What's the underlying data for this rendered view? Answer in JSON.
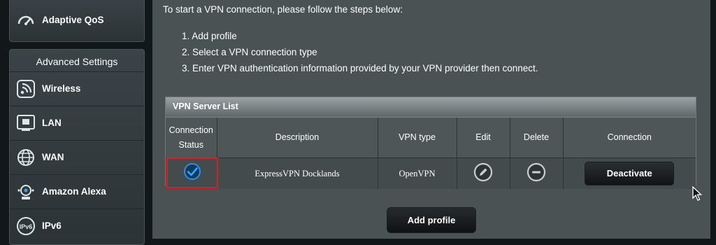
{
  "sidebar": {
    "qos_label": "Adaptive QoS",
    "advanced_title": "Advanced Settings",
    "items": [
      {
        "label": "Wireless",
        "icon": "wifi-icon"
      },
      {
        "label": "LAN",
        "icon": "lan-icon"
      },
      {
        "label": "WAN",
        "icon": "globe-icon"
      },
      {
        "label": "Amazon Alexa",
        "icon": "alexa-icon"
      },
      {
        "label": "IPv6",
        "icon": "ipv6-icon"
      }
    ]
  },
  "main": {
    "intro": "To start a VPN connection, please follow the steps below:",
    "steps": [
      "1. Add profile",
      "2. Select a VPN connection type",
      "3. Enter VPN authentication information provided by your VPN provider then connect."
    ],
    "panel_title": "VPN Server List",
    "columns": {
      "status_line1": "Connection",
      "status_line2": "Status",
      "description": "Description",
      "vpn_type": "VPN type",
      "edit": "Edit",
      "delete": "Delete",
      "connection": "Connection"
    },
    "rows": [
      {
        "status": "connected",
        "description": "ExpressVPN Docklands",
        "vpn_type": "OpenVPN",
        "action_label": "Deactivate"
      }
    ],
    "add_profile_label": "Add profile"
  },
  "colors": {
    "highlight": "#e11b22",
    "check": "#2f8fe0",
    "panel_bg": "#4b5254"
  }
}
